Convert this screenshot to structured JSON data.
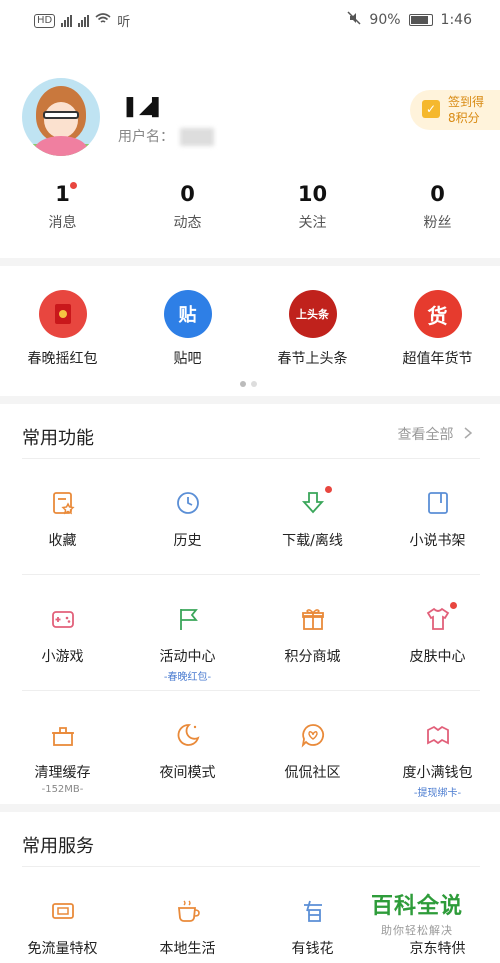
{
  "status_bar": {
    "network": "46",
    "speed": "听",
    "battery": "90%",
    "time": "1:46"
  },
  "profile": {
    "username": "\u0012‴",
    "user_id_label": "用户名：",
    "sign_in": {
      "line1": "签到得",
      "line2": "8积分"
    },
    "stats": [
      {
        "value": "1",
        "label": "消息",
        "has_dot": true
      },
      {
        "value": "0",
        "label": "动态"
      },
      {
        "value": "10",
        "label": "关注"
      },
      {
        "value": "0",
        "label": "粉丝"
      }
    ]
  },
  "banners": [
    {
      "label": "春晚摇红包",
      "icon": "red-envelope-icon",
      "color": "#e8463f"
    },
    {
      "label": "贴吧",
      "icon": "tieba-icon",
      "glyph": "贴",
      "color": "#2e7fe6"
    },
    {
      "label": "春节上头条",
      "icon": "headline-icon",
      "glyph": "上头条",
      "color": "#c0221c"
    },
    {
      "label": "超值年货节",
      "icon": "goods-icon",
      "glyph": "货",
      "color": "#e63b2e"
    }
  ],
  "common_functions": {
    "title": "常用功能",
    "see_all": "查看全部",
    "items": [
      {
        "label": "收藏",
        "icon": "favorites-icon"
      },
      {
        "label": "历史",
        "icon": "history-icon"
      },
      {
        "label": "下载/离线",
        "icon": "download-icon",
        "has_dot": true
      },
      {
        "label": "小说书架",
        "icon": "bookshelf-icon"
      },
      {
        "label": "小游戏",
        "icon": "game-icon"
      },
      {
        "label": "活动中心",
        "icon": "flag-icon",
        "sub": "-春晚红包-"
      },
      {
        "label": "积分商城",
        "icon": "gift-icon"
      },
      {
        "label": "皮肤中心",
        "icon": "shirt-icon",
        "has_dot": true
      },
      {
        "label": "清理缓存",
        "icon": "clean-icon",
        "sub": "-152MB-",
        "sub_gray": true
      },
      {
        "label": "夜间模式",
        "icon": "moon-icon"
      },
      {
        "label": "侃侃社区",
        "icon": "community-icon"
      },
      {
        "label": "度小满钱包",
        "icon": "wallet-icon",
        "sub": "-提现绑卡-"
      }
    ]
  },
  "common_services": {
    "title": "常用服务",
    "items": [
      {
        "label": "免流量特权",
        "icon": "free-traffic-icon"
      },
      {
        "label": "本地生活",
        "icon": "local-life-icon"
      },
      {
        "label": "有钱花",
        "icon": "loan-icon"
      },
      {
        "label": "京东特供",
        "icon": "jd-icon"
      }
    ]
  },
  "watermark": {
    "title": "百科全说",
    "subtitle": "助你轻松解决"
  },
  "colors": {
    "accent_red": "#e8463f",
    "icon_orange": "#e98a3a",
    "icon_blue": "#5b8fd6",
    "icon_green": "#3aa65a",
    "icon_pink": "#e2607a",
    "link_blue": "#4a7bd0",
    "watermark_green": "#2e9c3a"
  }
}
